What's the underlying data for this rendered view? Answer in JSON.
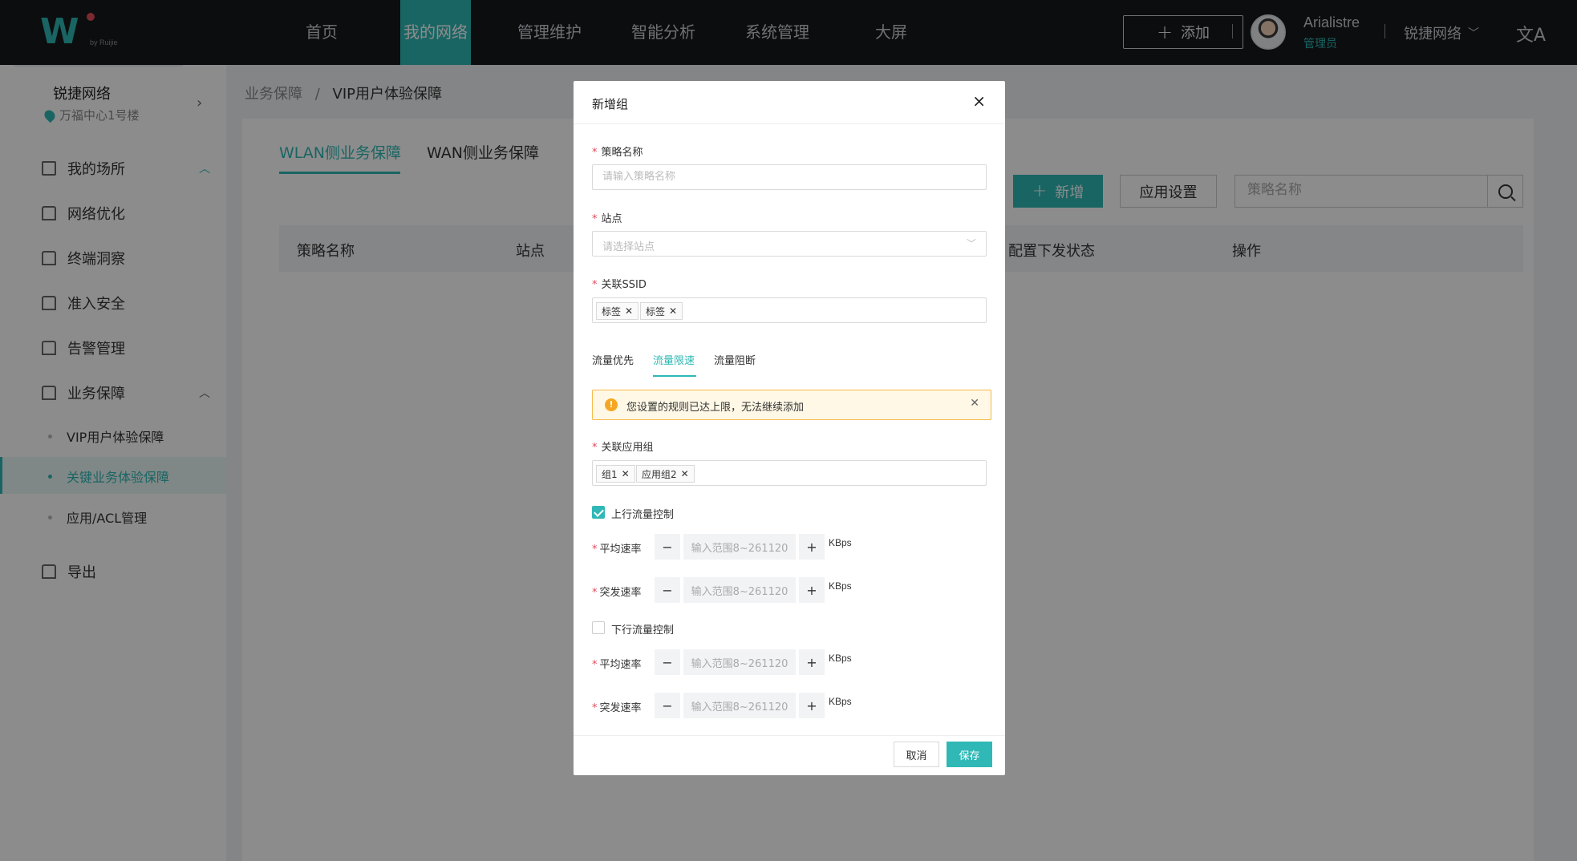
{
  "header": {
    "logo_by": "by Ruijie",
    "nav": [
      "首页",
      "我的网络",
      "管理维护",
      "智能分析",
      "系统管理",
      "大屏"
    ],
    "add_label": "添加",
    "user_name": "Arialistre",
    "user_role": "管理员",
    "org": "锐捷网络",
    "lang_icon": "translate-icon"
  },
  "sidebar": {
    "site_name": "锐捷网络",
    "site_location": "万福中心1号楼",
    "menu": [
      "我的场所",
      "网络优化",
      "终端洞察",
      "准入安全",
      "告警管理",
      "业务保障",
      "导出"
    ],
    "sub_items": [
      "VIP用户体验保障",
      "关键业务体验保障",
      "应用/ACL管理"
    ]
  },
  "main": {
    "breadcrumb_parent": "业务保障",
    "breadcrumb_sep": "/",
    "breadcrumb_current": "VIP用户体验保障",
    "tabs": [
      "WLAN侧业务保障",
      "WAN侧业务保障"
    ],
    "new_label": "新增",
    "app_settings_label": "应用设置",
    "search_placeholder": "策略名称",
    "table_headers": [
      "策略名称",
      "站点",
      "配置下发状态",
      "操作"
    ]
  },
  "modal": {
    "title": "新增组",
    "policy_name_label": "策略名称",
    "policy_name_placeholder": "请输入策略名称",
    "site_label": "站点",
    "site_placeholder": "请选择站点",
    "ssid_label": "关联SSID",
    "ssid_tags": [
      "标签",
      "标签"
    ],
    "sub_tabs": [
      "流量优先",
      "流量限速",
      "流量阻断"
    ],
    "active_sub_tab": "流量限速",
    "alert_message": "您设置的规则已达上限，无法继续添加",
    "app_group_label": "关联应用组",
    "app_group_tags": [
      "组1",
      "应用组2"
    ],
    "uplink_label": "上行流量控制",
    "uplink_checked": true,
    "downlink_label": "下行流量控制",
    "downlink_checked": false,
    "avg_rate_label": "平均速率",
    "burst_rate_label": "突发速率",
    "rate_placeholder": "输入范围8~261120",
    "unit": "KBps",
    "cancel_label": "取消",
    "save_label": "保存"
  },
  "colors": {
    "accent": "#2fb8b5",
    "topbar": "#16191d",
    "required": "#e04b5a",
    "warning": "#f5a623"
  }
}
